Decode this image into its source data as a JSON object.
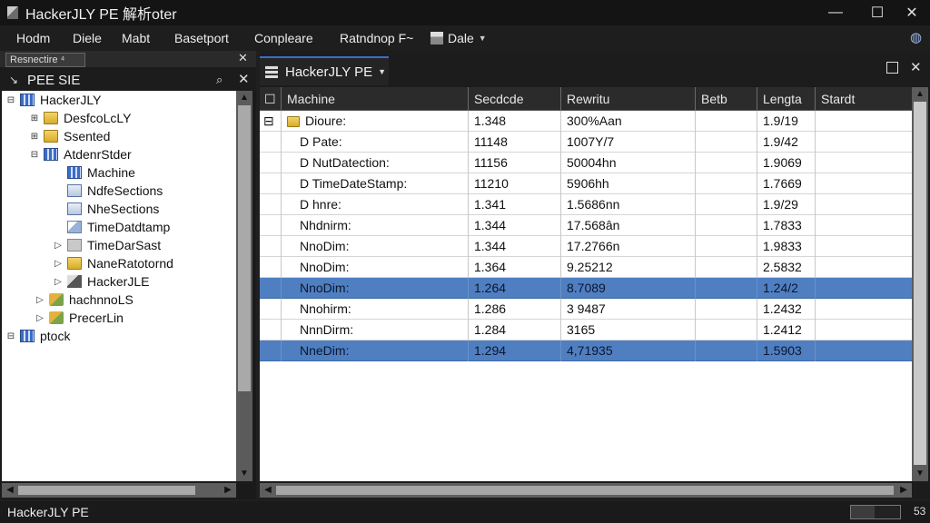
{
  "window": {
    "title": "HackerJLY PE 解析oter",
    "minimize_label": "—",
    "maximize_label": "☐",
    "close_label": "✕"
  },
  "menu": {
    "items": [
      "Hodm",
      "Diele",
      "Mabt",
      "Basetport",
      "Conpleare",
      "Ratndnop F~"
    ],
    "dale_label": "Dale",
    "globe_label": "◍"
  },
  "left_panel": {
    "tab_label": "Resnectire ⁴",
    "title": "PEE SIE",
    "tree": [
      {
        "label": "HackerJLY",
        "icon": "grid-icon",
        "twisty": "⊟"
      },
      {
        "label": "DesfcoLcLY",
        "icon": "folder-icon",
        "twisty": "⊞"
      },
      {
        "label": "Ssented",
        "icon": "folder-icon",
        "twisty": "⊞"
      },
      {
        "label": "AtdenrStder",
        "icon": "grid-icon",
        "twisty": "⊟"
      },
      {
        "label": "Machine",
        "icon": "grid-icon",
        "twisty": ""
      },
      {
        "label": "NdfeSections",
        "icon": "doc-icon",
        "twisty": ""
      },
      {
        "label": "NheSections",
        "icon": "doc-icon",
        "twisty": ""
      },
      {
        "label": "TimeDatdtamp",
        "icon": "image-icon",
        "twisty": ""
      },
      {
        "label": "TimeDarSast",
        "icon": "gray-icon",
        "twisty": "▷"
      },
      {
        "label": "NaneRatotornd",
        "icon": "folder-icon",
        "twisty": "▷"
      },
      {
        "label": "HackerJLE",
        "icon": "arrow-icon",
        "twisty": "▷"
      },
      {
        "label": "hachnnoLS",
        "icon": "check-icon",
        "twisty": "▷"
      },
      {
        "label": "PrecerLin",
        "icon": "check-icon",
        "twisty": "▷"
      },
      {
        "label": "ptock",
        "icon": "grid-icon",
        "twisty": "⊟"
      }
    ]
  },
  "right_panel": {
    "tab_title": "HackerJLY PE",
    "columns": [
      "Machine",
      "Secdcde",
      "Rewritu",
      "Betb",
      "Lengta",
      "Stardt"
    ],
    "rows": [
      {
        "name": "Dioure:",
        "c1": "1.348",
        "c2": "300%Aan",
        "c3": "",
        "c4": "1.9/19",
        "c5": "",
        "selected": false
      },
      {
        "name": "D Pate:",
        "c1": "11148",
        "c2": "1007Y/7",
        "c3": "",
        "c4": "1.9/42",
        "c5": "",
        "selected": false
      },
      {
        "name": "D NutDatection:",
        "c1": "11156",
        "c2": "50004hn",
        "c3": "",
        "c4": "1.9069",
        "c5": "",
        "selected": false
      },
      {
        "name": "D TimeDateStamp:",
        "c1": "11210",
        "c2": "5906hh",
        "c3": "",
        "c4": "1.7669",
        "c5": "",
        "selected": false
      },
      {
        "name": "D hnre:",
        "c1": "1.341",
        "c2": "1.5686nn",
        "c3": "",
        "c4": "1.9/29",
        "c5": "",
        "selected": false
      },
      {
        "name": "Nhdnirm:",
        "c1": "1.344",
        "c2": "17.568ân",
        "c3": "",
        "c4": "1.7833",
        "c5": "",
        "selected": false
      },
      {
        "name": "NnoDim:",
        "c1": "1.344",
        "c2": "17.2766n",
        "c3": "",
        "c4": "1.9833",
        "c5": "",
        "selected": false
      },
      {
        "name": "NnoDim:",
        "c1": "1.364",
        "c2": "9.25212",
        "c3": "",
        "c4": "2.5832",
        "c5": "",
        "selected": false
      },
      {
        "name": "NnoDim:",
        "c1": "1.264",
        "c2": "8.7089",
        "c3": "",
        "c4": "1.24/2",
        "c5": "",
        "selected": true
      },
      {
        "name": "Nnohirm:",
        "c1": "1.286",
        "c2": "3 9487",
        "c3": "",
        "c4": "1.2432",
        "c5": "",
        "selected": false
      },
      {
        "name": "NnnDirm:",
        "c1": "1.284",
        "c2": "3165",
        "c3": "",
        "c4": "1.2412",
        "c5": "",
        "selected": false
      },
      {
        "name": "NneDim:",
        "c1": "1.294",
        "c2": "4,71935",
        "c3": "",
        "c4": "1.5903",
        "c5": "",
        "selected": true
      }
    ]
  },
  "status": {
    "text": "HackerJLY PE",
    "number": "53"
  }
}
